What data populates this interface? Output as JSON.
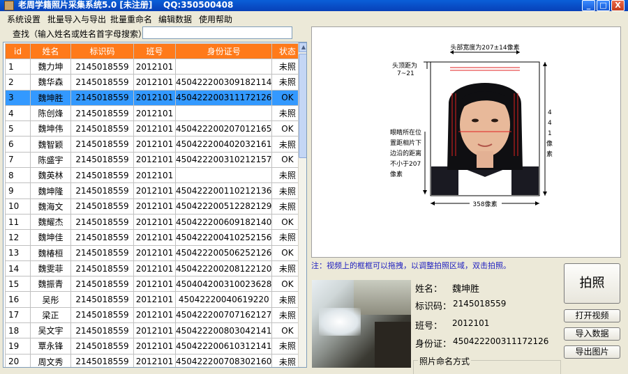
{
  "window": {
    "title": "老周学籍照片采集系统5.0 [未注册]",
    "qq": "QQ:350500408",
    "minimize": "_",
    "maximize": "□",
    "close": "X"
  },
  "menu": {
    "items": [
      "系统设置",
      "批量导入与导出",
      "批量重命名",
      "编辑数据",
      "使用帮助"
    ]
  },
  "search": {
    "label": "查找（输入姓名或姓名首字母搜索）",
    "value": ""
  },
  "table": {
    "columns": [
      "id",
      "姓名",
      "标识码",
      "班号",
      "身份证号",
      "状态"
    ],
    "selected_index": 2,
    "rows": [
      [
        "1",
        "魏力坤",
        "2145018559",
        "2012101",
        "",
        "未照"
      ],
      [
        "2",
        "魏华森",
        "2145018559",
        "2012101",
        "450422200309182114",
        "未照"
      ],
      [
        "3",
        "魏坤胜",
        "2145018559",
        "2012101",
        "450422200311172126",
        "OK"
      ],
      [
        "4",
        "陈创烽",
        "2145018559",
        "2012101",
        "",
        "未照"
      ],
      [
        "5",
        "魏坤伟",
        "2145018559",
        "2012101",
        "450422200207012165",
        "OK"
      ],
      [
        "6",
        "魏智颖",
        "2145018559",
        "2012101",
        "450422200402032161",
        "未照"
      ],
      [
        "7",
        "陈盛宇",
        "2145018559",
        "2012101",
        "450422200310212157",
        "OK"
      ],
      [
        "8",
        "魏英林",
        "2145018559",
        "2012101",
        "",
        "未照"
      ],
      [
        "9",
        "魏坤隆",
        "2145018559",
        "2012101",
        "450422200110212136",
        "未照"
      ],
      [
        "10",
        "魏海文",
        "2145018559",
        "2012101",
        "450422200512282129",
        "未照"
      ],
      [
        "11",
        "魏耀杰",
        "2145018559",
        "2012101",
        "450422200609182140",
        "OK"
      ],
      [
        "12",
        "魏坤佳",
        "2145018559",
        "2012101",
        "450422200410252156",
        "未照"
      ],
      [
        "13",
        "魏椿桓",
        "2145018559",
        "2012101",
        "450422200506252126",
        "OK"
      ],
      [
        "14",
        "魏雯菲",
        "2145018559",
        "2012101",
        "450422200208122120",
        "未照"
      ],
      [
        "15",
        "魏振青",
        "2145018559",
        "2012101",
        "450404200310023628",
        "OK"
      ],
      [
        "16",
        "吴彤",
        "2145018559",
        "2012101",
        "45042220040619220",
        "未照"
      ],
      [
        "17",
        "梁正",
        "2145018559",
        "2012101",
        "450422200707162127",
        "未照"
      ],
      [
        "18",
        "吴文宇",
        "2145018559",
        "2012101",
        "450422200803042141",
        "OK"
      ],
      [
        "19",
        "覃永锋",
        "2145018559",
        "2012101",
        "450422200610312141",
        "未照"
      ],
      [
        "20",
        "周文秀",
        "2145018559",
        "2012101",
        "450422200708302160",
        "未照"
      ]
    ]
  },
  "diagram": {
    "head_width": "头部宽度为207±14像素",
    "top_dist_1": "头顶距为",
    "top_dist_2": "7~21",
    "eye_1": "眼睛所在位",
    "eye_2": "置距相片下",
    "eye_3": "边沿的距离",
    "eye_4": "不小于207",
    "eye_5": "像素",
    "height_digits": [
      "4",
      "4",
      "1",
      "像",
      "素"
    ],
    "width_label": "358像素"
  },
  "note": "注：视频上的框框可以拖拽，以调整拍照区域，双击拍照。",
  "info": {
    "name_label": "姓名：",
    "name_value": "魏坤胜",
    "code_label": "标识码：",
    "code_value": "2145018559",
    "class_label": "班号：",
    "class_value": "2012101",
    "id_label": "身份证：",
    "id_value": "450422200311172126"
  },
  "buttons": {
    "capture": "拍照",
    "open_video": "打开视频",
    "import_data": "导入数据",
    "export_image": "导出图片"
  },
  "naming": {
    "label": "照片命名方式"
  },
  "colors": {
    "header_bg": "#ff7a1a",
    "selected_row": "#3399ff",
    "note_text": "#2020c0"
  }
}
